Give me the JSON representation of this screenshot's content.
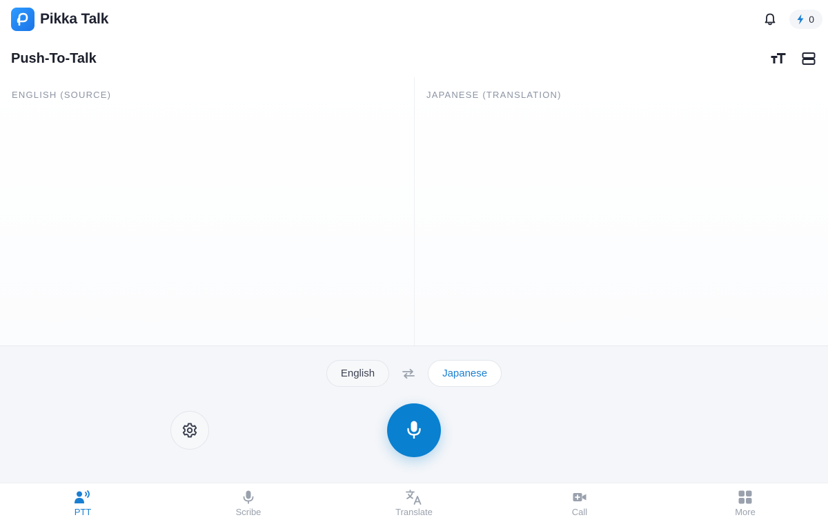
{
  "app": {
    "name": "Pikka Talk",
    "credits": "0"
  },
  "page": {
    "title": "Push-To-Talk"
  },
  "panels": {
    "source_label": "ENGLISH (SOURCE)",
    "target_label": "JAPANESE (TRANSLATION)"
  },
  "languages": {
    "source": "English",
    "target": "Japanese"
  },
  "nav": {
    "items": [
      {
        "label": "PTT",
        "icon": "ptt-speaker-icon",
        "active": true
      },
      {
        "label": "Scribe",
        "icon": "microphone-icon",
        "active": false
      },
      {
        "label": "Translate",
        "icon": "translate-icon",
        "active": false
      },
      {
        "label": "Call",
        "icon": "video-call-icon",
        "active": false
      },
      {
        "label": "More",
        "icon": "grid-icon",
        "active": false
      }
    ]
  },
  "colors": {
    "accent": "#0a80d0",
    "active_nav": "#1a7fd1",
    "inactive_nav": "#9aa1ad",
    "credit_bolt": "#1a7fd1"
  }
}
